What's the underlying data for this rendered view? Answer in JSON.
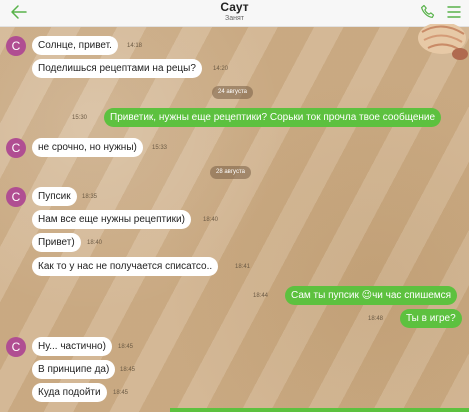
{
  "header": {
    "title": "Саут",
    "status": "Занят",
    "back_icon": "arrow-left-icon",
    "call_icon": "phone-icon",
    "menu_icon": "hamburger-menu-icon",
    "accent_color": "#58b24a"
  },
  "avatar_letter": "С",
  "dates": [
    "24 августа",
    "28 августа"
  ],
  "messages": [
    {
      "text": "Солнце, привет.",
      "time": "14:18",
      "dir": "in"
    },
    {
      "text": "Поделишься рецептами на рецы?",
      "time": "14:20",
      "dir": "in"
    },
    {
      "text": "Приветик, нужны еще рецептики? Сорьки ток прочла твое сообщение",
      "time": "15:30",
      "dir": "out"
    },
    {
      "text": "не срочно, но нужны)",
      "time": "15:33",
      "dir": "in"
    },
    {
      "text": "Пупсик",
      "time": "18:35",
      "dir": "in"
    },
    {
      "text": "Нам все еще нужны рецептики)",
      "time": "18:40",
      "dir": "in"
    },
    {
      "text": "Привет)",
      "time": "18:40",
      "dir": "in"
    },
    {
      "text": "Как то у нас не получается списатсо..",
      "time": "18:41",
      "dir": "in"
    },
    {
      "text": "Сам ты пупсик 😉чи час спишемся",
      "time": "18:44",
      "dir": "out"
    },
    {
      "text": "Ты в игре?",
      "time": "18:48",
      "dir": "out"
    },
    {
      "text": "Ну... частично)",
      "time": "18:45",
      "dir": "in"
    },
    {
      "text": "В принципе да)",
      "time": "18:45",
      "dir": "in"
    },
    {
      "text": "Куда подойти",
      "time": "18:45",
      "dir": "in"
    }
  ],
  "colors": {
    "incoming_bubble": "#ffffff",
    "outgoing_bubble": "#5dc13f",
    "avatar": "#b04e92"
  }
}
